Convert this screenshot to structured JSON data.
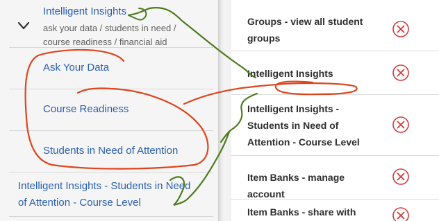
{
  "left_panel": {
    "expanded_item": {
      "title": "Intelligent Insights",
      "description": "ask your data / students in need / course readiness / financial aid",
      "chevron_icon": "chevron-down-icon"
    },
    "sub_items": [
      {
        "label": "Ask Your Data"
      },
      {
        "label": "Course Readiness"
      },
      {
        "label": "Students in Need of Attention"
      }
    ],
    "standalone_item": {
      "label": "Intelligent Insights - Students in Need of Attention - Course Level"
    }
  },
  "right_panel": {
    "items": [
      {
        "label": "Groups - view all student groups",
        "action_icon": "remove-circle-icon"
      },
      {
        "label": "Intelligent Insights",
        "action_icon": "remove-circle-icon"
      },
      {
        "label": "Intelligent Insights - Students in Need of Attention - Course Level",
        "action_icon": "remove-circle-icon"
      },
      {
        "label": "Item Banks - manage account",
        "action_icon": "remove-circle-icon"
      },
      {
        "label": "Item Banks - share with",
        "action_icon": "remove-circle-icon"
      }
    ]
  },
  "colors": {
    "link_blue": "#2a5fb0",
    "remove_red": "#d23b3b",
    "annotation_orange": "#e0441c",
    "annotation_green": "#4c7a1e"
  }
}
